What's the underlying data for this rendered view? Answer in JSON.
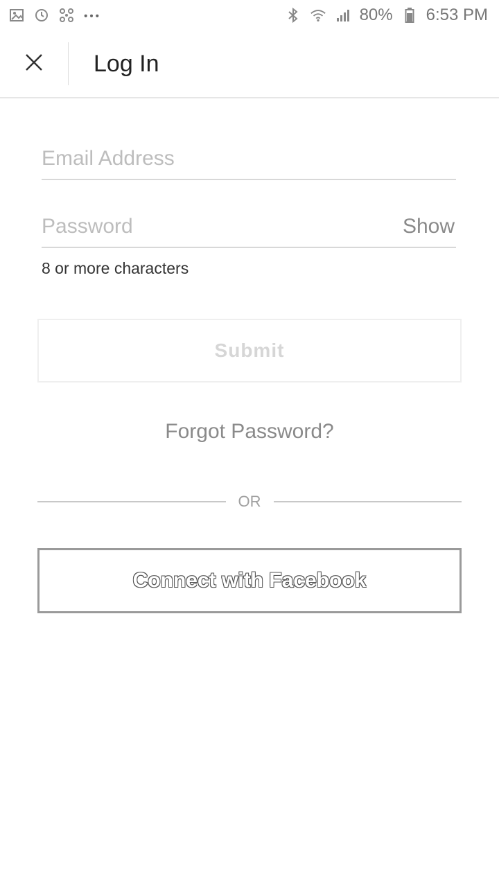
{
  "status_bar": {
    "left_icons": [
      "gallery-icon",
      "sync-icon",
      "fan-icon",
      "more-dots-icon"
    ],
    "battery": "80%",
    "time": "6:53 PM"
  },
  "app_bar": {
    "title": "Log In"
  },
  "form": {
    "email_placeholder": "Email Address",
    "password_placeholder": "Password",
    "show_label": "Show",
    "password_hint": "8 or more characters",
    "submit_label": "Submit",
    "forgot_label": "Forgot Password?",
    "or_label": "OR",
    "facebook_label": "Connect with Facebook"
  }
}
